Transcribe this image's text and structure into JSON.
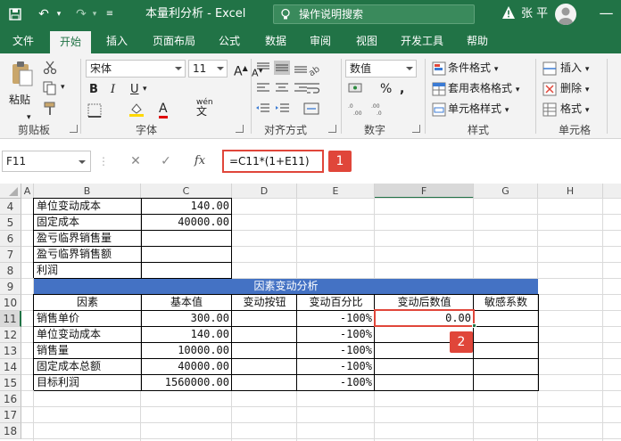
{
  "window": {
    "title": "本量利分析 - Excel",
    "search_placeholder": "操作说明搜索",
    "user": "张 平"
  },
  "tabs": [
    "文件",
    "开始",
    "插入",
    "页面布局",
    "公式",
    "数据",
    "审阅",
    "视图",
    "开发工具",
    "帮助"
  ],
  "ribbon": {
    "clipboard": {
      "label": "剪贴板",
      "paste": "粘贴"
    },
    "font": {
      "label": "字体",
      "name": "宋体",
      "size": "11",
      "bold": "B",
      "italic": "I",
      "underline": "U",
      "grow": "A",
      "shrink": "A",
      "wen": "wén"
    },
    "align": {
      "label": "对齐方式"
    },
    "number": {
      "label": "数字",
      "format": "数值"
    },
    "styles": {
      "label": "样式",
      "conditional": "条件格式",
      "table": "套用表格格式",
      "cell": "单元格样式"
    },
    "cells": {
      "label": "单元格",
      "insert": "插入",
      "delete": "删除",
      "format": "格式"
    }
  },
  "formula_bar": {
    "name_box": "F11",
    "fx": "fx",
    "formula": "=C11*(1+E11)"
  },
  "callouts": [
    "1",
    "2"
  ],
  "columns": [
    "A",
    "B",
    "C",
    "D",
    "E",
    "F",
    "G",
    "H"
  ],
  "rows": [
    "4",
    "5",
    "6",
    "7",
    "8",
    "9",
    "10",
    "11",
    "12",
    "13",
    "14",
    "15",
    "16",
    "17",
    "18"
  ],
  "cells": {
    "r4": {
      "b": "单位变动成本",
      "c": "140.00"
    },
    "r5": {
      "b": "固定成本",
      "c": "40000.00"
    },
    "r6": {
      "b": "盈亏临界销售量"
    },
    "r7": {
      "b": "盈亏临界销售额"
    },
    "r8": {
      "b": "利润"
    },
    "r9": {
      "banner": "因素变动分析"
    },
    "r10": {
      "b": "因素",
      "c": "基本值",
      "d": "变动按钮",
      "e": "变动百分比",
      "f": "变动后数值",
      "g": "敏感系数"
    },
    "r11": {
      "b": "销售单价",
      "c": "300.00",
      "e": "-100%",
      "f": "0.00"
    },
    "r12": {
      "b": "单位变动成本",
      "c": "140.00",
      "e": "-100%"
    },
    "r13": {
      "b": "销售量",
      "c": "10000.00",
      "e": "-100%"
    },
    "r14": {
      "b": "固定成本总额",
      "c": "40000.00",
      "e": "-100%"
    },
    "r15": {
      "b": "目标利润",
      "c": "1560000.00",
      "e": "-100%"
    }
  },
  "colors": {
    "excel_green": "#217346",
    "banner": "#4472c4",
    "callout": "#e0463a"
  }
}
